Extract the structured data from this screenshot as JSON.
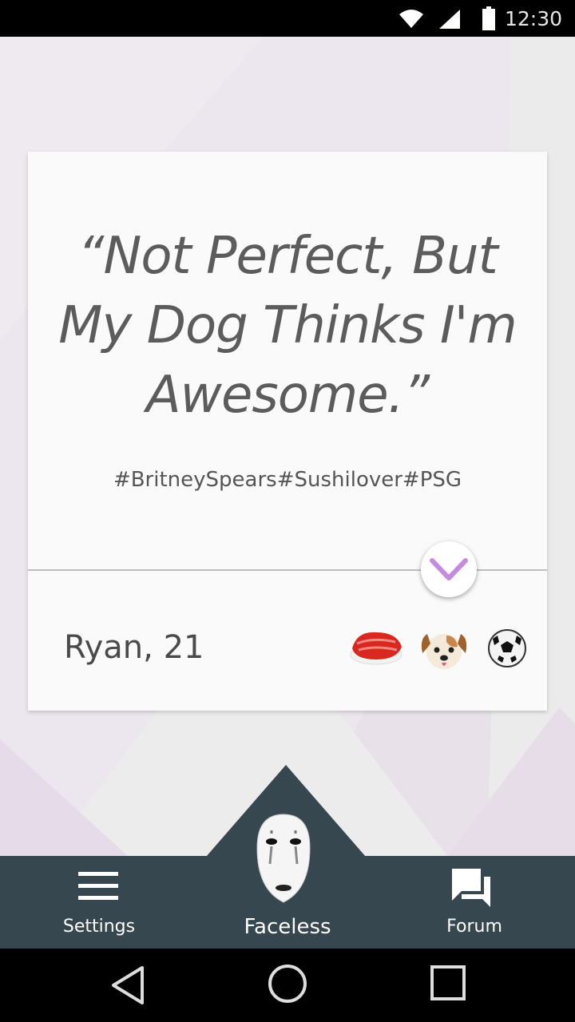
{
  "status_bar": {
    "time": "12:30",
    "icons": [
      "wifi-icon",
      "signal-icon",
      "battery-icon"
    ]
  },
  "card": {
    "quote": "“Not Perfect, But My Dog Thinks I'm Awesome.”",
    "quote_lines": [
      "“Not Perfect, But",
      "My Dog Thinks I'm",
      "Awesome.”"
    ],
    "hashtags": "#BritneySpears#Sushilover#PSG",
    "name_age": "Ryan, 21",
    "interest_icons": [
      "sushi-icon",
      "dog-icon",
      "soccer-ball-icon"
    ]
  },
  "bottom_nav": {
    "settings_label": "Settings",
    "center_label": "Faceless",
    "forum_label": "Forum"
  },
  "colors": {
    "background": "#ece6ef",
    "nav_bar": "#37474f",
    "accent_chevron": "#c58be0",
    "card": "#fafafa"
  }
}
